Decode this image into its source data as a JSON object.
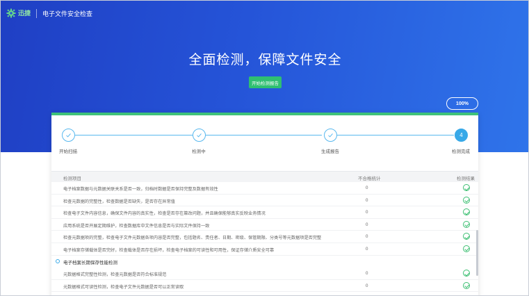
{
  "header": {
    "logo_text": "迅捷",
    "app_title": "电子文件安全检查"
  },
  "hero": {
    "title": "全面检测，保障文件安全",
    "start_button": "开始检测报告",
    "progress": "100%"
  },
  "steps": [
    {
      "label": "开始扫描",
      "state": "done"
    },
    {
      "label": "检测中",
      "state": "done"
    },
    {
      "label": "生成报告",
      "state": "done"
    },
    {
      "label": "检测完成",
      "state": "active",
      "number": "4"
    }
  ],
  "table": {
    "headers": {
      "item": "检测项目",
      "count": "不合格统计",
      "result": "检测结果"
    },
    "rows_top": [
      {
        "desc": "电子档案数据与元数据关联关系是否一致，归档时数据是否保持完整及数据有效性",
        "count": "0"
      },
      {
        "desc": "检查元数据的完整性，检查数据是否缺失，是否存在异常值",
        "count": "0"
      },
      {
        "desc": "检查电子文件内容信息，确保文件内容的真实性，检查是否存在篡改问题，并且确保能够真实反映业务情况",
        "count": "0"
      },
      {
        "desc": "应用系统是否开展定期维护，检查数据库中文件信息是否与实际文件保持一致",
        "count": "0"
      },
      {
        "desc": "检查元数据项的完整，检查电子文件元数据各项内容是否完整，包括题名、责任者、日期、密级、保管期限、分类号等元数据项是否完整",
        "count": "0"
      },
      {
        "desc": "电子档案存储载体是否完好，检查载体是否存在损坏，检查电子档案的可读性和可用性，保证存储介质安全可靠",
        "count": "0"
      }
    ],
    "group_title": "电子档案长期保存性能检测",
    "rows_bottom": [
      {
        "desc": "元数据格式完整性检测，检查元数据是否符合标准规范",
        "count": "0"
      },
      {
        "desc": "元数据格式可读性检测，检查电子文件元数据是否可以正常读取",
        "count": "0"
      }
    ]
  },
  "colors": {
    "hero_start": "#1f3fc4",
    "hero_end": "#2f74ea",
    "accent_green": "#2fbf71",
    "step_blue": "#38a9e8"
  }
}
